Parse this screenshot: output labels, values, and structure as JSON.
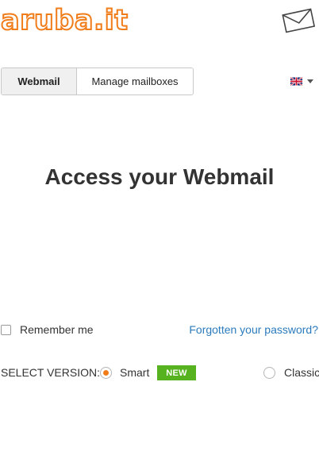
{
  "header": {
    "logo_text": "aruba.it",
    "brand_color": "#f07c1a",
    "mail_icon": "envelope-icon"
  },
  "tabs": [
    {
      "label": "Webmail",
      "active": true
    },
    {
      "label": "Manage mailboxes",
      "active": false
    }
  ],
  "language": {
    "icon": "uk-flag-icon"
  },
  "main": {
    "title": "Access your Webmail"
  },
  "options": {
    "remember_label": "Remember me",
    "remember_checked": false,
    "forgot_link": "Forgotten your password?",
    "link_color": "#2b7bbd"
  },
  "version": {
    "label": "SELECT VERSION:",
    "smart_label": "Smart",
    "smart_selected": true,
    "badge": "NEW",
    "badge_color": "#56b31f",
    "classic_label": "Classic",
    "classic_selected": false
  }
}
